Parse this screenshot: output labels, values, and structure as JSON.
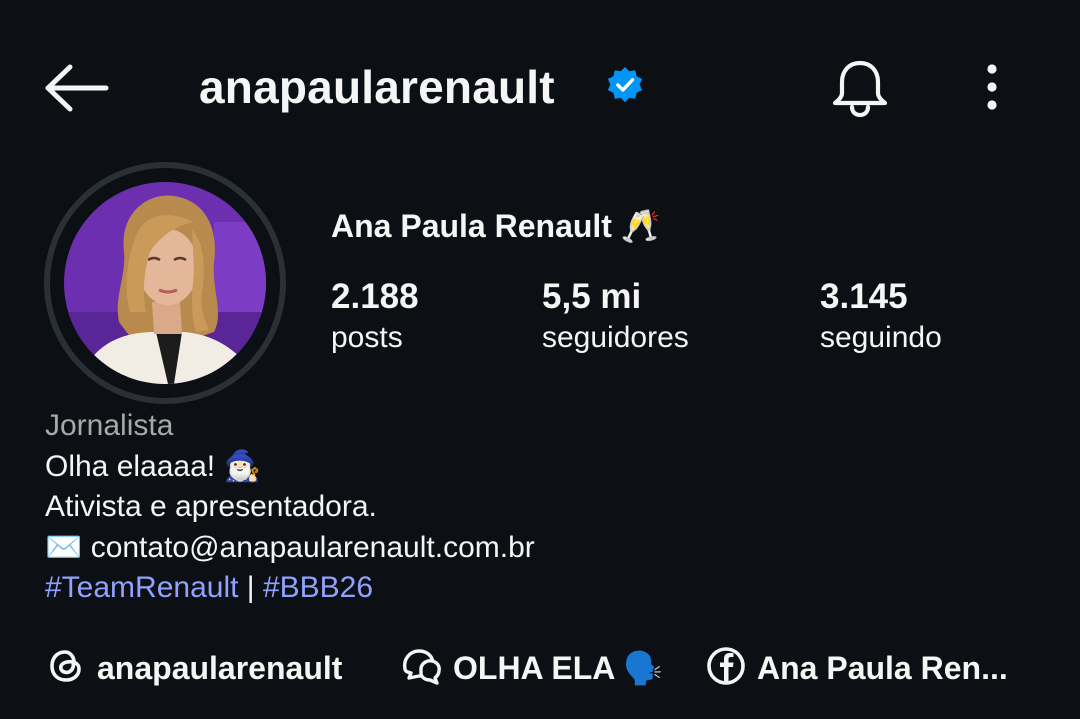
{
  "header": {
    "username": "anapaularenault",
    "verified_color": "#0095f6"
  },
  "profile": {
    "full_name": "Ana Paula Renault 🥂",
    "stats": {
      "posts": {
        "value": "2.188",
        "label": "posts"
      },
      "followers": {
        "value": "5,5 mi",
        "label": "seguidores"
      },
      "following": {
        "value": "3.145",
        "label": "seguindo"
      }
    }
  },
  "bio": {
    "category": "Jornalista",
    "line1": "Olha elaaaa! 🧙🏻‍♂️",
    "line2": "Ativista e apresentadora.",
    "line3": "✉️ contato@anapaularenault.com.br",
    "hashtag1": "#TeamRenault",
    "separator": "|",
    "hashtag2": "#BBB26",
    "hashtag_color": "#8fa2ff"
  },
  "links": {
    "threads": {
      "icon": "threads-icon",
      "label": "anapaularenault"
    },
    "channel": {
      "icon": "broadcast-channel-icon",
      "label": "OLHA ELA 🗣️"
    },
    "facebook": {
      "icon": "facebook-icon",
      "label": "Ana Paula Ren..."
    }
  }
}
